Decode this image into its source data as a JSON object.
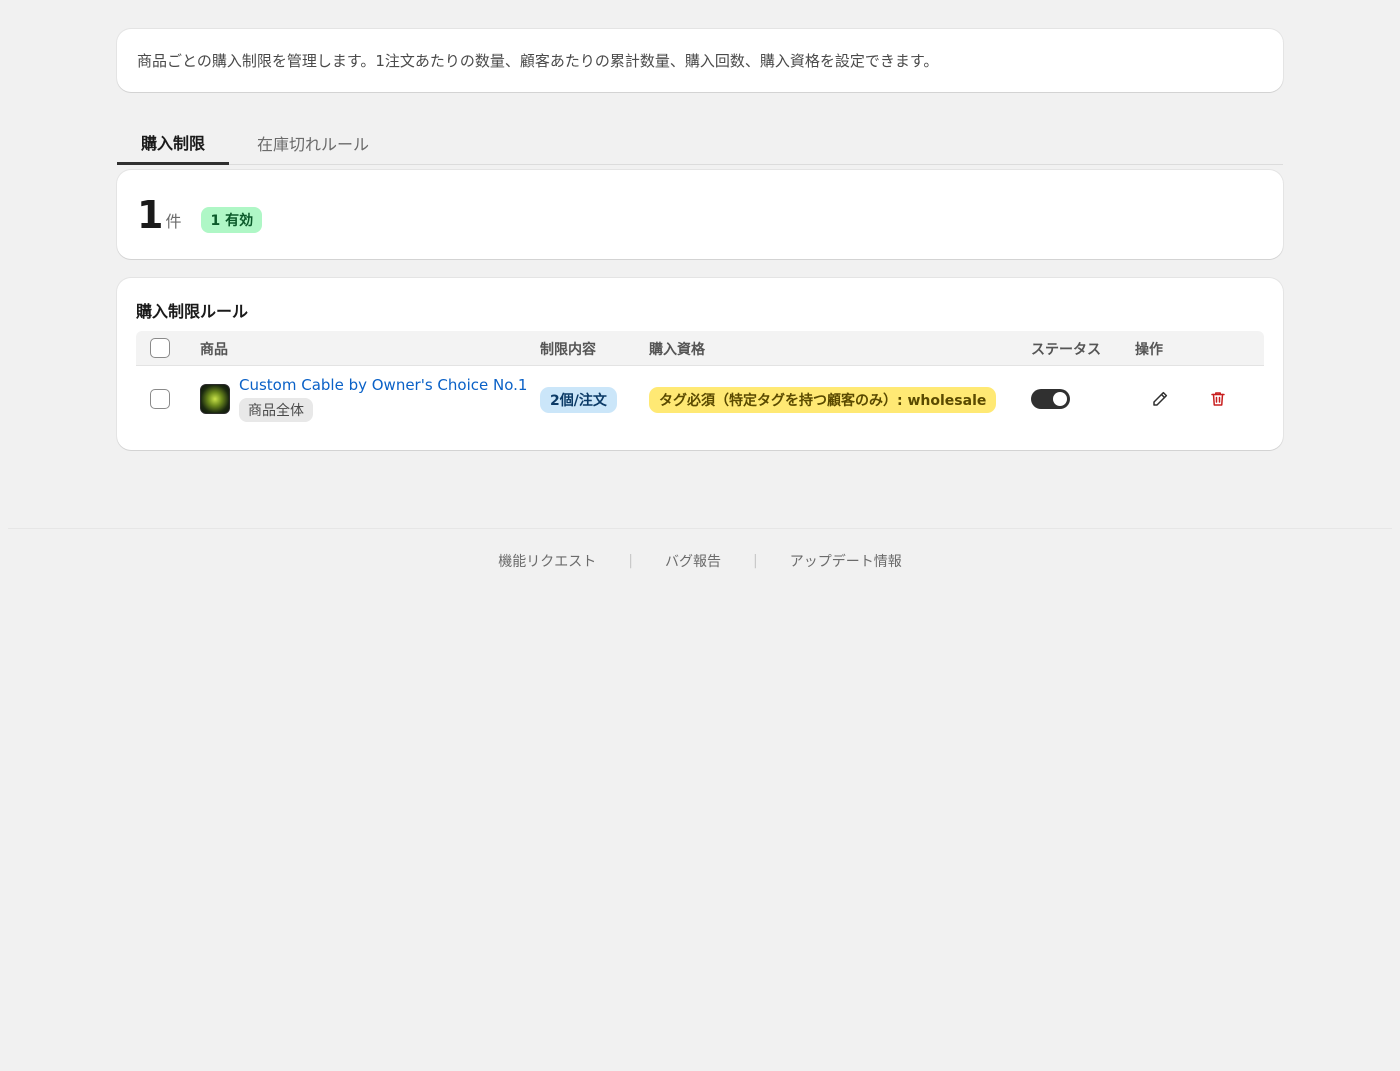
{
  "intro": {
    "text": "商品ごとの購入制限を管理します。1注文あたりの数量、顧客あたりの累計数量、購入回数、購入資格を設定できます。"
  },
  "tabs": [
    {
      "label": "購入制限",
      "active": true
    },
    {
      "label": "在庫切れルール",
      "active": false
    }
  ],
  "summary": {
    "count": "1",
    "unit": "件",
    "active_badge": "1 有効"
  },
  "rules": {
    "title": "購入制限ルール",
    "columns": {
      "product": "商品",
      "limit": "制限内容",
      "eligibility": "購入資格",
      "status": "ステータス",
      "actions": "操作"
    },
    "rows": [
      {
        "product_name": "Custom Cable by Owner's Choice No.1",
        "scope": "商品全体",
        "limit": "2個/注文",
        "eligibility": "タグ必須（特定タグを持つ顧客のみ）: wholesale",
        "status_on": true,
        "thumbnail_icon": "product-thumbnail-icon",
        "edit_icon": "pencil-icon",
        "delete_icon": "trash-icon"
      }
    ]
  },
  "footer": {
    "links": [
      "機能リクエスト",
      "バグ報告",
      "アップデート情報"
    ],
    "separator": "|"
  },
  "colors": {
    "background": "#f1f1f1",
    "link": "#0a61c7",
    "active_badge": "#aff7c6",
    "limit_badge": "#cbe6f9",
    "eligibility_badge": "#ffe974",
    "delete": "#c81e1e"
  }
}
